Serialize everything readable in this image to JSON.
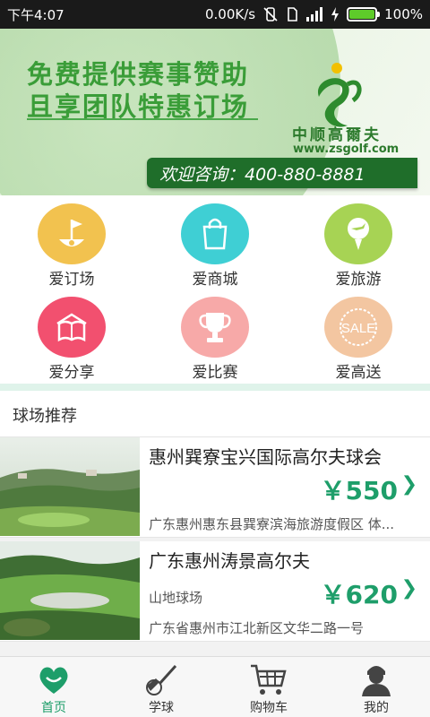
{
  "status_bar": {
    "time": "下午4:07",
    "speed": "0.00K/s",
    "battery": "100%"
  },
  "banner": {
    "line1": "免费提供赛事赞助",
    "line2": "且享团队特惠订场",
    "brand_cn": "中顺高爾夫",
    "brand_url": "www.zsgolf.com",
    "hotline": "欢迎咨询：400-880-8881"
  },
  "menu": {
    "items": [
      {
        "label": "爱订场",
        "icon": "golf-flag-icon",
        "color": "#f2c24f"
      },
      {
        "label": "爱商城",
        "icon": "shopping-bag-icon",
        "color": "#3fcfd4"
      },
      {
        "label": "爱旅游",
        "icon": "travel-golf-icon",
        "color": "#a7d354"
      },
      {
        "label": "爱分享",
        "icon": "open-book-icon",
        "color": "#f2506f"
      },
      {
        "label": "爱比赛",
        "icon": "trophy-icon",
        "color": "#f7a9a8"
      },
      {
        "label": "爱高送",
        "icon": "sale-tag-icon",
        "color": "#f3c6a1"
      }
    ]
  },
  "section": {
    "title": "球场推荐"
  },
  "courses": [
    {
      "name": "惠州巽寮宝兴国际高尔夫球会",
      "type": "",
      "price": "￥550",
      "address": "广东惠州惠东县巽寮滨海旅游度假区 体..."
    },
    {
      "name": "广东惠州涛景高尔夫",
      "type": "山地球场",
      "price": "￥620",
      "address": "广东省惠州市江北新区文华二路一号"
    }
  ],
  "tabbar": {
    "tabs": [
      {
        "label": "首页",
        "icon": "home-heart-icon"
      },
      {
        "label": "学球",
        "icon": "golf-club-icon"
      },
      {
        "label": "购物车",
        "icon": "shopping-cart-icon"
      },
      {
        "label": "我的",
        "icon": "user-icon"
      }
    ],
    "active_color": "#1e9e6a"
  }
}
